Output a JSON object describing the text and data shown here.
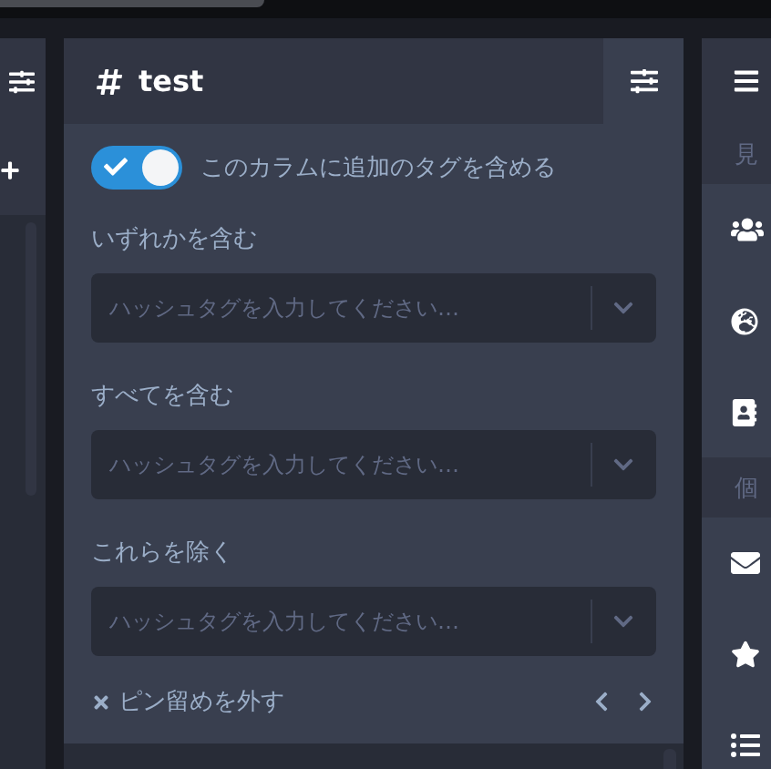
{
  "column": {
    "title": "test"
  },
  "toggle": {
    "label": "このカラムに追加のタグを含める",
    "on": true
  },
  "sections": [
    {
      "label": "いずれかを含む",
      "placeholder": "ハッシュタグを入力してください…"
    },
    {
      "label": "すべてを含む",
      "placeholder": "ハッシュタグを入力してください…"
    },
    {
      "label": "これらを除く",
      "placeholder": "ハッシュタグを入力してください…"
    }
  ],
  "footer": {
    "unpin": "ピン留めを外す"
  },
  "nav": {
    "section_labels": [
      "見",
      "個"
    ]
  }
}
